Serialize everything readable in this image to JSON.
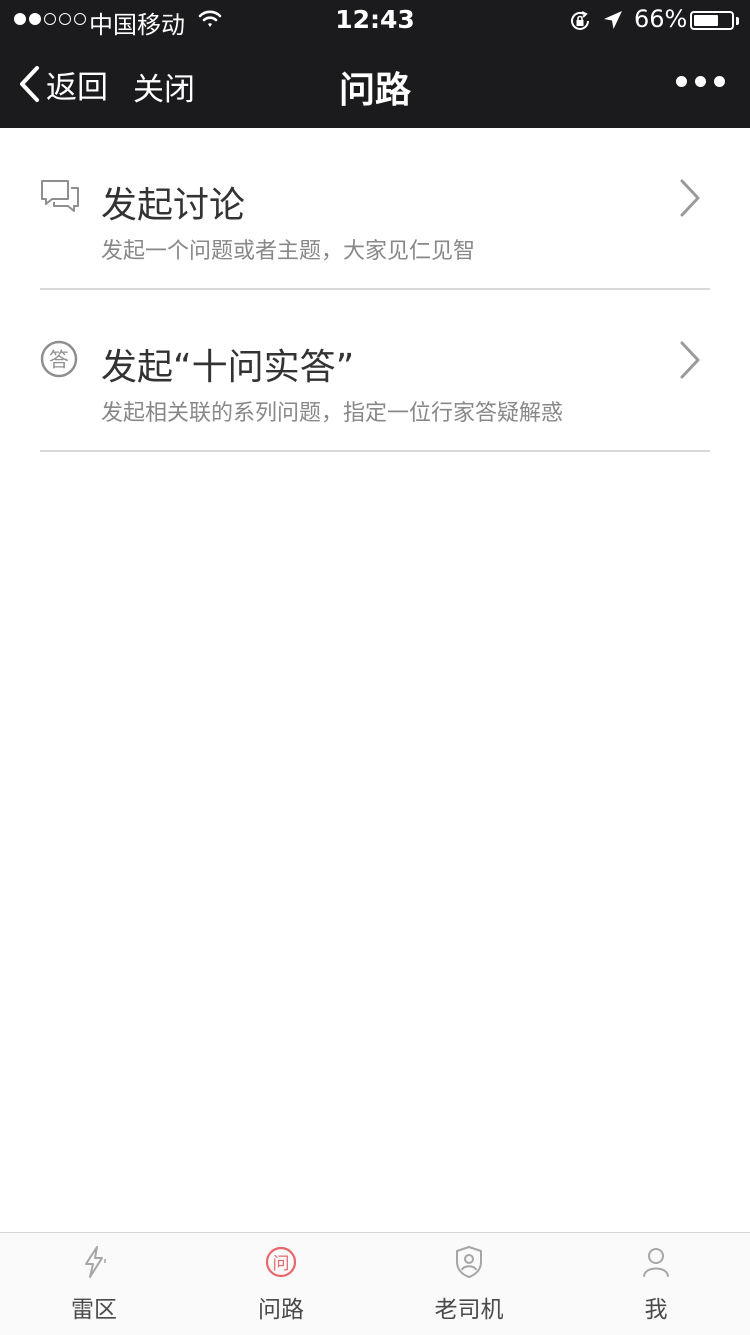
{
  "status_bar": {
    "carrier": "中国移动",
    "time": "12:43",
    "battery_percent": "66%",
    "battery_level": 0.66,
    "signal_strength": 2,
    "signal_total": 5
  },
  "nav": {
    "back_label": "返回",
    "close_label": "关闭",
    "title": "问路"
  },
  "menu": {
    "items": [
      {
        "title": "发起讨论",
        "desc": "发起一个问题或者主题，大家见仁见智",
        "icon": "chat-bubbles-icon"
      },
      {
        "title": "发起“十问实答”",
        "desc": "发起相关联的系列问题，指定一位行家答疑解惑",
        "icon": "answer-badge-icon",
        "icon_glyph": "答"
      }
    ]
  },
  "tab_bar": {
    "active_color": "#e8676a",
    "inactive_color": "#a6a6a6",
    "tabs": [
      {
        "label": "雷区",
        "icon": "lightning-icon"
      },
      {
        "label": "问路",
        "icon": "ask-icon",
        "icon_glyph": "问",
        "active": true
      },
      {
        "label": "老司机",
        "icon": "shield-user-icon"
      },
      {
        "label": "我",
        "icon": "person-icon"
      }
    ]
  }
}
